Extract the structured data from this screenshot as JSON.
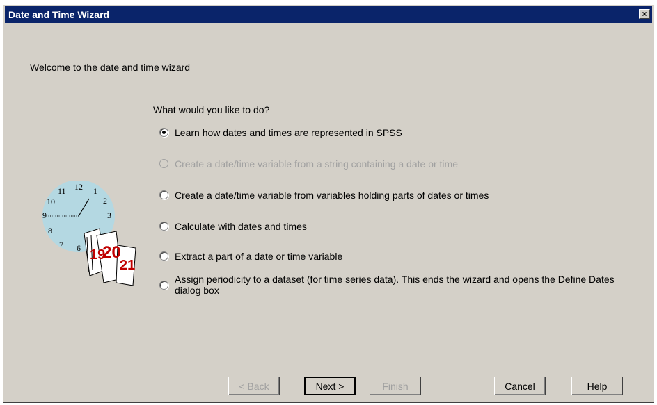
{
  "window": {
    "title": "Date and Time Wizard",
    "close_label": "×"
  },
  "welcome": "Welcome to the date and time wizard",
  "question": "What would you like to do?",
  "options": [
    {
      "label": "Learn how dates and times are represented in SPSS",
      "checked": true,
      "enabled": true
    },
    {
      "label": "Create a date/time variable from a string containing a date or time",
      "checked": false,
      "enabled": false
    },
    {
      "label": "Create a date/time variable from  variables holding parts of dates or times",
      "checked": false,
      "enabled": true
    },
    {
      "label": "Calculate with dates and times",
      "checked": false,
      "enabled": true
    },
    {
      "label": "Extract a part of a date or time variable",
      "checked": false,
      "enabled": true
    },
    {
      "label": "Assign periodicity to a dataset (for time series data). This ends the wizard and opens the Define Dates dialog box",
      "checked": false,
      "enabled": true
    }
  ],
  "illustration": {
    "clock_numbers": [
      "12",
      "1",
      "2",
      "3",
      "11",
      "10",
      "9",
      "8",
      "7",
      "6"
    ],
    "calendar_numbers": [
      "19",
      "20",
      "21"
    ],
    "icon": "clock-calendar-icon"
  },
  "buttons": {
    "back": "< Back",
    "next": "Next >",
    "finish": "Finish",
    "cancel": "Cancel",
    "help": "Help"
  }
}
